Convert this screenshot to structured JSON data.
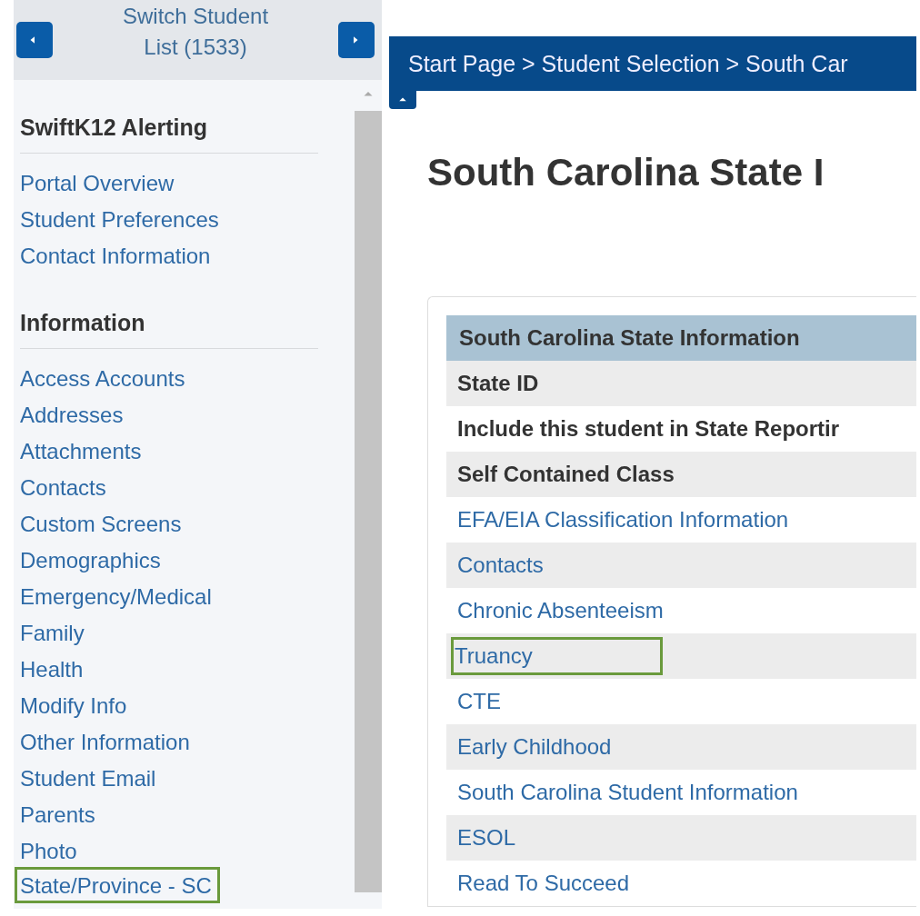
{
  "sidebar": {
    "switcher": {
      "label": "Switch Student List (1533)"
    },
    "sections": [
      {
        "heading": "SwiftK12 Alerting",
        "items": [
          {
            "label": "Portal Overview",
            "highlighted": false
          },
          {
            "label": "Student Preferences",
            "highlighted": false
          },
          {
            "label": "Contact Information",
            "highlighted": false
          }
        ]
      },
      {
        "heading": "Information",
        "items": [
          {
            "label": "Access Accounts",
            "highlighted": false
          },
          {
            "label": "Addresses",
            "highlighted": false
          },
          {
            "label": "Attachments",
            "highlighted": false
          },
          {
            "label": "Contacts",
            "highlighted": false
          },
          {
            "label": "Custom Screens",
            "highlighted": false
          },
          {
            "label": "Demographics",
            "highlighted": false
          },
          {
            "label": "Emergency/Medical",
            "highlighted": false
          },
          {
            "label": "Family",
            "highlighted": false
          },
          {
            "label": "Health",
            "highlighted": false
          },
          {
            "label": "Modify Info",
            "highlighted": false
          },
          {
            "label": "Other Information",
            "highlighted": false
          },
          {
            "label": "Student Email",
            "highlighted": false
          },
          {
            "label": "Parents",
            "highlighted": false
          },
          {
            "label": "Photo",
            "highlighted": false
          },
          {
            "label": "State/Province - SC",
            "highlighted": true
          }
        ]
      }
    ]
  },
  "breadcrumb": "Start Page > Student Selection > South Car",
  "page_title": "South Carolina State I",
  "table": {
    "header": "South Carolina State Information",
    "rows": [
      {
        "label": "State ID",
        "kind": "label",
        "highlighted": false
      },
      {
        "label": "Include this student in State Reportir",
        "kind": "label",
        "highlighted": false
      },
      {
        "label": "Self Contained Class",
        "kind": "label",
        "highlighted": false
      },
      {
        "label": "EFA/EIA Classification Information",
        "kind": "link",
        "highlighted": false
      },
      {
        "label": "Contacts",
        "kind": "link",
        "highlighted": false
      },
      {
        "label": "Chronic Absenteeism",
        "kind": "link",
        "highlighted": false
      },
      {
        "label": "Truancy",
        "kind": "link",
        "highlighted": true
      },
      {
        "label": "CTE",
        "kind": "link",
        "highlighted": false
      },
      {
        "label": "Early Childhood",
        "kind": "link",
        "highlighted": false
      },
      {
        "label": "South Carolina Student Information",
        "kind": "link",
        "highlighted": false
      },
      {
        "label": "ESOL",
        "kind": "link",
        "highlighted": false
      },
      {
        "label": "Read To Succeed",
        "kind": "link",
        "highlighted": false
      }
    ]
  }
}
